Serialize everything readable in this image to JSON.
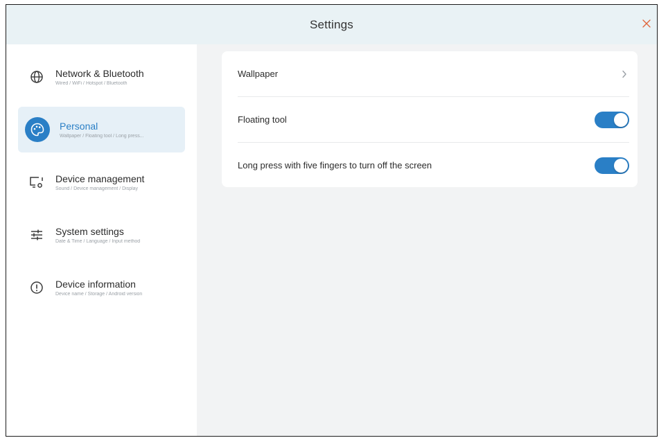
{
  "window": {
    "title": "Settings"
  },
  "sidebar": {
    "items": [
      {
        "label": "Network & Bluetooth",
        "subtitle": "Wired / WiFi / Hotspot / Bluetooth",
        "icon": "globe-icon",
        "selected": false
      },
      {
        "label": "Personal",
        "subtitle": "Wallpaper / Floating tool / Long press...",
        "icon": "palette-icon",
        "selected": true
      },
      {
        "label": "Device management",
        "subtitle": "Sound / Device management / Display",
        "icon": "device-icon",
        "selected": false
      },
      {
        "label": "System settings",
        "subtitle": "Date & Time / Language / Input method",
        "icon": "sliders-icon",
        "selected": false
      },
      {
        "label": "Device information",
        "subtitle": "Device name / Storage / Android version",
        "icon": "info-icon",
        "selected": false
      }
    ]
  },
  "personal": {
    "rows": [
      {
        "label": "Wallpaper",
        "control": "chevron"
      },
      {
        "label": "Floating tool",
        "control": "toggle",
        "on": true
      },
      {
        "label": "Long press with five fingers to turn off the screen",
        "control": "toggle",
        "on": true
      }
    ]
  },
  "colors": {
    "accent": "#2a7fc6",
    "title_bar": "#e9f2f5",
    "selected_bg": "#e6f0f7",
    "content_bg": "#f2f3f4"
  }
}
